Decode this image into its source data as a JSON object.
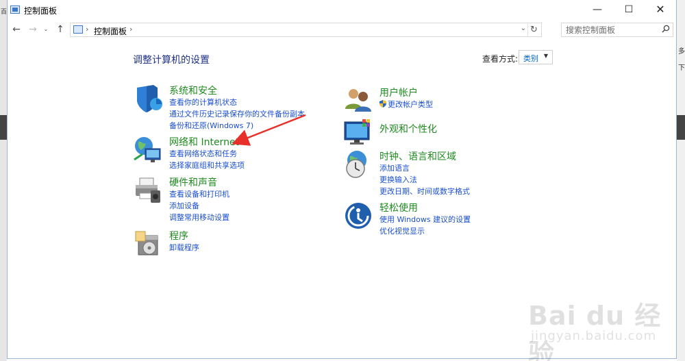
{
  "window": {
    "title": "控制面板",
    "minimize_glyph": "—",
    "maximize_glyph": "☐",
    "close_glyph": "✕"
  },
  "navigation": {
    "back_glyph": "←",
    "forward_glyph": "→",
    "recent_glyph": "⌄",
    "up_glyph": "↑",
    "address_path": "控制面板",
    "address_separator": "›",
    "refresh_glyph": "↻",
    "dropdown_glyph": "⌄"
  },
  "search": {
    "placeholder": "搜索控制面板",
    "icon": "search-icon"
  },
  "main": {
    "title": "调整计算机的设置",
    "view_by_label": "查看方式:",
    "view_by_value": "类别"
  },
  "categories_left": [
    {
      "title": "系统和安全",
      "icon": "shield-icon",
      "links": [
        "查看你的计算机状态",
        "通过文件历史记录保存你的文件备份副本",
        "备份和还原(Windows 7)"
      ]
    },
    {
      "title": "网络和 Internet",
      "icon": "network-globe-icon",
      "links": [
        "查看网络状态和任务",
        "选择家庭组和共享选项"
      ]
    },
    {
      "title": "硬件和声音",
      "icon": "printer-icon",
      "links": [
        "查看设备和打印机",
        "添加设备",
        "调整常用移动设置"
      ]
    },
    {
      "title": "程序",
      "icon": "programs-disc-icon",
      "links": [
        "卸载程序"
      ]
    }
  ],
  "categories_right": [
    {
      "title": "用户帐户",
      "icon": "users-icon",
      "links": [
        "更改帐户类型"
      ]
    },
    {
      "title": "外观和个性化",
      "icon": "monitor-palette-icon",
      "links": []
    },
    {
      "title": "时钟、语言和区域",
      "icon": "clock-globe-icon",
      "links": [
        "添加语言",
        "更换输入法",
        "更改日期、时间或数字格式"
      ]
    },
    {
      "title": "轻松使用",
      "icon": "ease-of-access-icon",
      "links": [
        "使用 Windows 建议的设置",
        "优化视觉显示"
      ]
    }
  ],
  "annotation": {
    "arrow_color": "#e8302a"
  },
  "background": {
    "left_glyph": "百",
    "right_text_1": "多",
    "right_text_2": "下"
  },
  "watermark": {
    "main": "Bai du 经验",
    "url": "jingyan.baidu.com"
  },
  "colors": {
    "category_title": "#1f8a1f",
    "link": "#1a4fd0",
    "page_title": "#1e3287"
  }
}
